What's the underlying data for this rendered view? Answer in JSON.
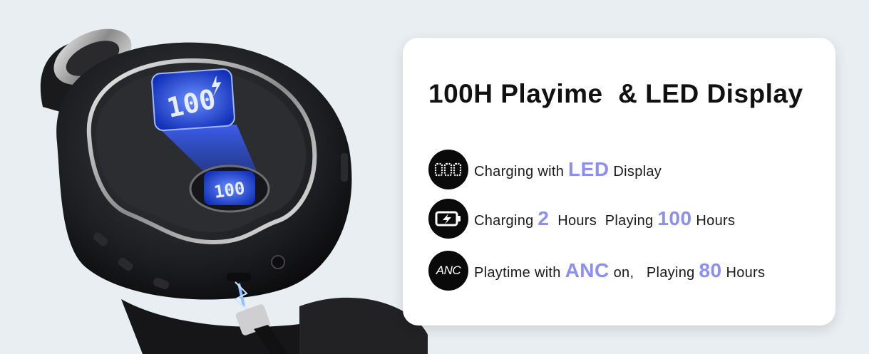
{
  "card": {
    "title": "100H Playime  & LED Display",
    "features": [
      {
        "icon": "led-digits-icon",
        "icon_label": "",
        "parts": [
          "Charging with ",
          "LED",
          " Display"
        ]
      },
      {
        "icon": "battery-charging-icon",
        "icon_label": "",
        "parts": [
          "Charging ",
          "2",
          "  Hours  Playing ",
          "100",
          " Hours"
        ]
      },
      {
        "icon": "anc-icon",
        "icon_label": "ANC",
        "parts": [
          "Playtime with ",
          "ANC",
          " on,   Playing ",
          "80",
          " Hours"
        ]
      }
    ]
  },
  "product": {
    "display_readout": "100",
    "small_display_readout": "100"
  },
  "colors": {
    "highlight": "#8c8ef0",
    "background": "#e9eef2",
    "card": "#ffffff",
    "led_glow": "#3d6bff"
  }
}
